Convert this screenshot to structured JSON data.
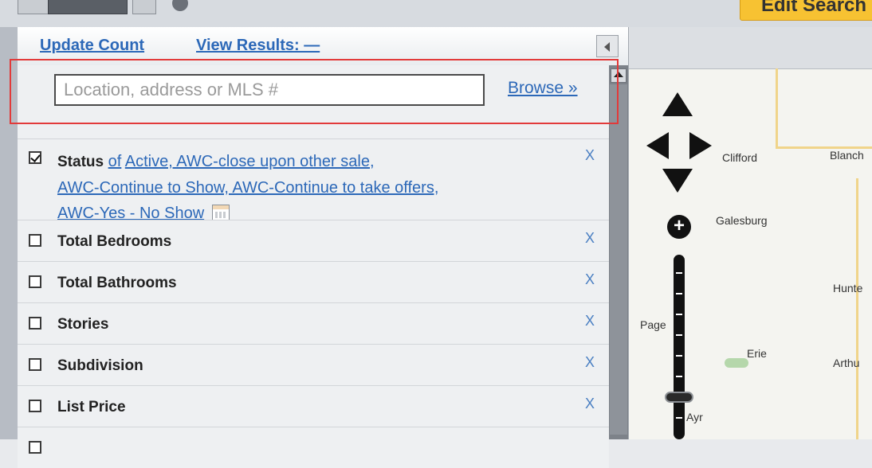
{
  "toolbar": {
    "edit_search_label": "Edit Search"
  },
  "panel": {
    "update_count_label": "Update Count",
    "view_results_label": "View Results: —"
  },
  "search": {
    "placeholder": "Location, address or MLS #",
    "value": "",
    "browse_label": "Browse »"
  },
  "filters": {
    "status": {
      "label": "Status",
      "prefix": "of",
      "values": [
        "Active, AWC-close upon other sale,",
        "AWC-Continue to Show, AWC-Continue to take offers,",
        "AWC-Yes - No Show"
      ],
      "checked": true,
      "remove": "X"
    },
    "items": [
      {
        "label": "Total Bedrooms",
        "checked": false,
        "remove": "X"
      },
      {
        "label": "Total Bathrooms",
        "checked": false,
        "remove": "X"
      },
      {
        "label": "Stories",
        "checked": false,
        "remove": "X"
      },
      {
        "label": "Subdivision",
        "checked": false,
        "remove": "X"
      },
      {
        "label": "List Price",
        "checked": false,
        "remove": "X"
      }
    ]
  },
  "map": {
    "places": [
      "Clifford",
      "Blanch",
      "Galesburg",
      "Hunte",
      "Page",
      "Erie",
      "Arthu",
      "Ayr"
    ]
  },
  "colors": {
    "link": "#2c68b8",
    "highlight": "#e23a3a",
    "accent": "#f7c232"
  }
}
